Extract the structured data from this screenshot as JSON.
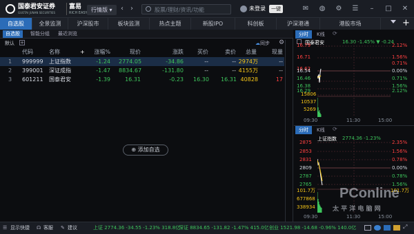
{
  "titlebar": {
    "brand_main": "国泰君安证券",
    "brand_sub": "GUOTAI JUNAN SECURITIES",
    "product": "富易",
    "product_sub": "RICH EASY",
    "quote_mode": "行情版",
    "search_placeholder": "股票/理财/资讯/功能",
    "login_text": "未登录",
    "trade_badge": "一键"
  },
  "tabs": [
    {
      "label": "自选股",
      "active": true
    },
    {
      "label": "全景监测"
    },
    {
      "label": "沪深股市"
    },
    {
      "label": "板块监测"
    },
    {
      "label": "热点主题"
    },
    {
      "label": "新股IPO"
    },
    {
      "label": "科创板"
    },
    {
      "label": "沪深港通"
    },
    {
      "label": "港股市场"
    }
  ],
  "subtabs": [
    "自选股",
    "智能分组",
    "最近浏览"
  ],
  "list_name": "默认",
  "sync_label": "同步",
  "columns": [
    "代码",
    "名称",
    "涨幅%",
    "现价",
    "涨跌",
    "买价",
    "卖价",
    "总量",
    "现量"
  ],
  "rows": [
    {
      "idx": "1",
      "code": "999999",
      "name": "上证指数",
      "chg_pct": "-1.24",
      "price": "2774.05",
      "chg": "-34.86",
      "bid": "--",
      "ask": "--",
      "vol": "2974万",
      "cur": "--"
    },
    {
      "idx": "2",
      "code": "399001",
      "name": "深证成指",
      "chg_pct": "-1.47",
      "price": "8834.67",
      "chg": "-131.80",
      "bid": "--",
      "ask": "--",
      "vol": "4155万",
      "cur": "--"
    },
    {
      "idx": "3",
      "code": "601211",
      "name": "国泰君安",
      "chg_pct": "-1.39",
      "price": "16.31",
      "chg": "-0.23",
      "bid": "16.30",
      "ask": "16.31",
      "vol": "40828",
      "cur": "17"
    }
  ],
  "add_button": "添加自选",
  "chart_top": {
    "tabs": [
      "分时",
      "K线"
    ],
    "name": "国泰君安",
    "header": "16.30  -1.45%  ▼ -0.24",
    "left_labels": [
      "16.79",
      "16.71",
      "16.62",
      "16.54",
      "16.46",
      "16.38",
      "16.29",
      "15806",
      "10537",
      "5269"
    ],
    "right_labels": [
      "2.12%",
      "1.56%",
      "0.71%",
      "0.00%",
      "0.71%",
      "1.56%",
      "2.12%"
    ],
    "times": [
      "09:30",
      "11:30",
      "15:00"
    ],
    "colors": {
      "up": "#ff4141",
      "down": "#3ec55c",
      "price_line": "#ffffff",
      "avg_line": "#f5c518"
    }
  },
  "chart_bottom": {
    "tabs": [
      "分时",
      "K线"
    ],
    "name": "上证指数",
    "header": "2774.36  -1.23%",
    "left_labels": [
      "2875",
      "2853",
      "2831",
      "2809",
      "2787",
      "2765",
      "101.7万",
      "677868",
      "338934"
    ],
    "right_labels": [
      "2.35%",
      "1.56%",
      "0.78%",
      "0.00%",
      "0.78%",
      "1.56%",
      "101.7万"
    ],
    "times": [
      "09:30",
      "11:30",
      "15:00"
    ],
    "watermark": "PConline",
    "watermark_sub": "太 平 洋 电 脑 网"
  },
  "statusbar": {
    "quick_show": "显示快捷",
    "customer": "客服",
    "suggest": "建议",
    "sh": "上证 2774.36  -34.55  -1.23%  318.8亿",
    "sz": "深证 8834.65  -131.82  -1.47%  415.0亿",
    "cy": "创业 1521.98  -14.68  -0.96%  140.0亿"
  }
}
